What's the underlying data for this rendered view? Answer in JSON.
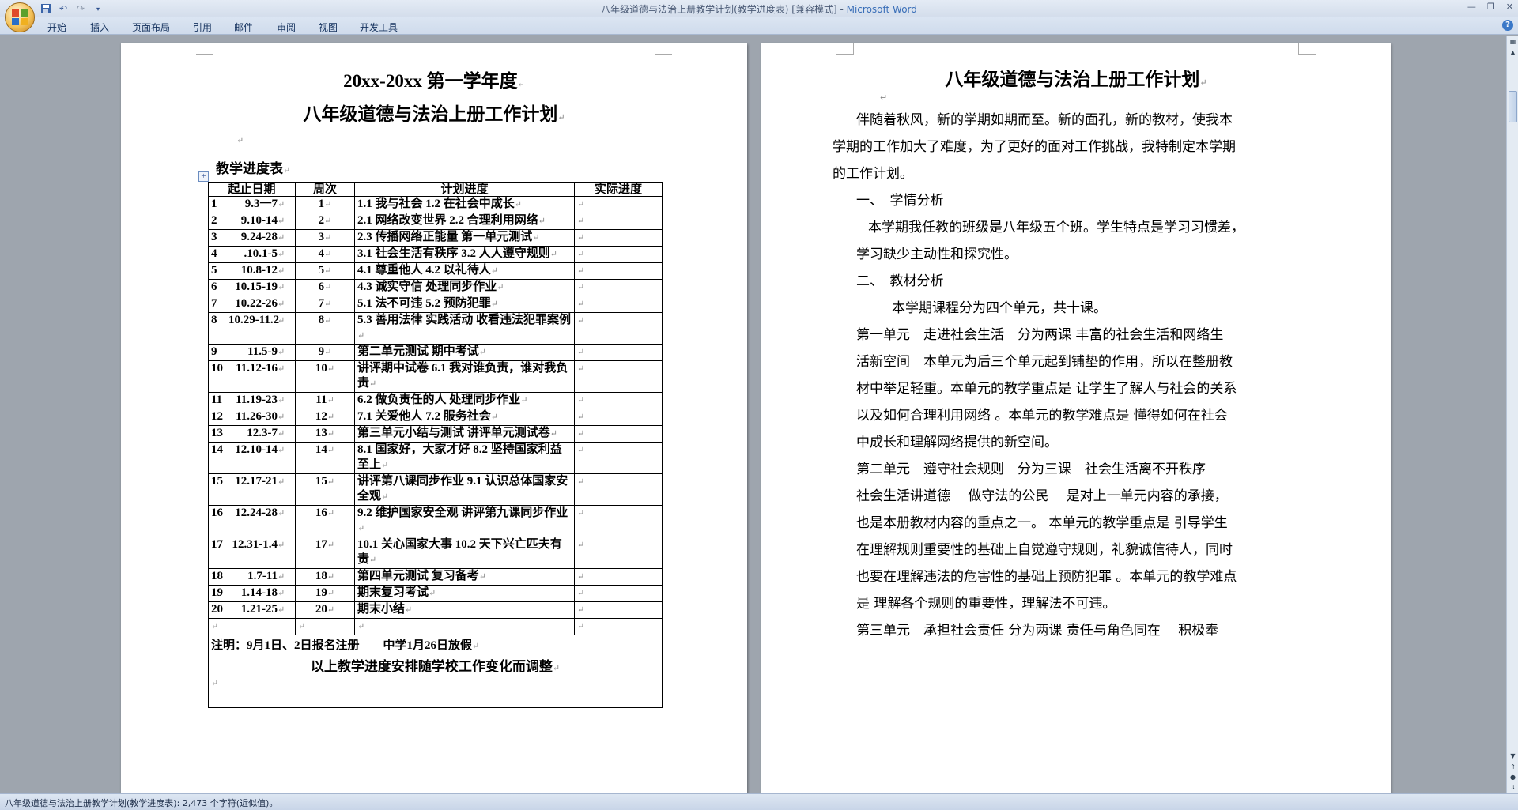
{
  "window": {
    "title_doc": "八年级道德与法治上册教学计划(教学进度表) [兼容模式] - ",
    "title_app": "Microsoft Word"
  },
  "ribbon": {
    "tabs": [
      "开始",
      "插入",
      "页面布局",
      "引用",
      "邮件",
      "审阅",
      "视图",
      "开发工具"
    ]
  },
  "page1": {
    "heading1": "20xx-20xx 第一学年度",
    "heading2": "八年级道德与法治上册工作计划",
    "section_title": "教学进度表",
    "table": {
      "headers": [
        "起止日期",
        "周次",
        "计划进度",
        "实际进度"
      ],
      "rows": [
        {
          "no": "1",
          "date": "9.3一7",
          "week": "1",
          "plan": "1.1 我与社会 1.2 在社会中成长"
        },
        {
          "no": "2",
          "date": "9.10-14",
          "week": "2",
          "plan": "2.1 网络改变世界 2.2 合理利用网络"
        },
        {
          "no": "3",
          "date": "9.24-28",
          "week": "3",
          "plan": "2.3 传播网络正能量 第一单元测试"
        },
        {
          "no": "4",
          "date": ".10.1-5",
          "week": "4",
          "plan": "3.1 社会生活有秩序 3.2 人人遵守规则"
        },
        {
          "no": "5",
          "date": "10.8-12",
          "week": "5",
          "plan": "4.1 尊重他人 4.2 以礼待人"
        },
        {
          "no": "6",
          "date": "10.15-19",
          "week": "6",
          "plan": "4.3 诚实守信 处理同步作业"
        },
        {
          "no": "7",
          "date": "10.22-26",
          "week": "7",
          "plan": "5.1 法不可违 5.2 预防犯罪"
        },
        {
          "no": "8",
          "date": "10.29-11.2",
          "week": "8",
          "plan": "5.3 善用法律 实践活动 收看违法犯罪案例"
        },
        {
          "no": "9",
          "date": "11.5-9",
          "week": "9",
          "plan": "第二单元测试 期中考试"
        },
        {
          "no": "10",
          "date": "11.12-16",
          "week": "10",
          "plan": "讲评期中试卷 6.1 我对谁负责，谁对我负责"
        },
        {
          "no": "11",
          "date": "11.19-23",
          "week": "11",
          "plan": "6.2 做负责任的人 处理同步作业"
        },
        {
          "no": "12",
          "date": "11.26-30",
          "week": "12",
          "plan": "7.1 关爱他人 7.2 服务社会"
        },
        {
          "no": "13",
          "date": "12.3-7",
          "week": "13",
          "plan": "第三单元小结与测试 讲评单元测试卷"
        },
        {
          "no": "14",
          "date": "12.10-14",
          "week": "14",
          "plan": "8.1 国家好，大家才好 8.2 坚持国家利益至上"
        },
        {
          "no": "15",
          "date": "12.17-21",
          "week": "15",
          "plan": "讲评第八课同步作业 9.1 认识总体国家安全观"
        },
        {
          "no": "16",
          "date": "12.24-28",
          "week": "16",
          "plan": "9.2 维护国家安全观 讲评第九课同步作业"
        },
        {
          "no": "17",
          "date": "12.31-1.4",
          "week": "17",
          "plan": "10.1 关心国家大事 10.2 天下兴亡匹夫有责"
        },
        {
          "no": "18",
          "date": "1.7-11",
          "week": "18",
          "plan": "第四单元测试 复习备考"
        },
        {
          "no": "19",
          "date": "1.14-18",
          "week": "19",
          "plan": "期末复习考试"
        },
        {
          "no": "20",
          "date": "1.21-25",
          "week": "20",
          "plan": "期末小结"
        }
      ],
      "note": "注明：9月1日、2日报名注册　　中学1月26日放假",
      "footer": "以上教学进度安排随学校工作变化而调整"
    }
  },
  "page2": {
    "title": "八年级道德与法治上册工作计划",
    "lines": [
      {
        "t": "伴随着秋风，新的学期如期而至。新的面孔，新的教材，使我本",
        "indent": 30
      },
      {
        "t": "学期的工作加大了难度，为了更好的面对工作挑战，我特制定本学期",
        "indent": 0
      },
      {
        "t": "的工作计划。",
        "indent": 0
      },
      {
        "t": "一、　学情分析",
        "indent": 30
      },
      {
        "t": "本学期我任教的班级是八年级五个班。学生特点是学习习惯差，",
        "indent": 45
      },
      {
        "t": "学习缺少主动性和探究性。",
        "indent": 30
      },
      {
        "t": "二、　教材分析",
        "indent": 30
      },
      {
        "t": "本学期课程分为四个单元，共十课。",
        "indent": 75
      },
      {
        "t": "第一单元　走进社会生活　分为两课  丰富的社会生活和网络生",
        "indent": 30
      },
      {
        "t": "活新空间　本单元为后三个单元起到铺垫的作用，所以在整册教",
        "indent": 30
      },
      {
        "t": "材中举足轻重。本单元的教学重点是 让学生了解人与社会的关系",
        "indent": 30
      },
      {
        "t": "以及如何合理利用网络 。本单元的教学难点是 懂得如何在社会",
        "indent": 30
      },
      {
        "t": "中成长和理解网络提供的新空间。",
        "indent": 30
      },
      {
        "t": "第二单元　遵守社会规则　分为三课　社会生活离不开秩序",
        "indent": 30
      },
      {
        "t": "社会生活讲道德　 做守法的公民　 是对上一单元内容的承接，",
        "indent": 30
      },
      {
        "t": "也是本册教材内容的重点之一。 本单元的教学重点是 引导学生",
        "indent": 30
      },
      {
        "t": "在理解规则重要性的基础上自觉遵守规则，礼貌诚信待人，同时",
        "indent": 30
      },
      {
        "t": "也要在理解违法的危害性的基础上预防犯罪 。本单元的教学难点",
        "indent": 30
      },
      {
        "t": "是 理解各个规则的重要性，理解法不可违。",
        "indent": 30
      },
      {
        "t": "第三单元　承担社会责任  分为两课  责任与角色同在　 积极奉",
        "indent": 30
      }
    ]
  },
  "statusbar": {
    "text": "八年级道德与法治上册教学计划(教学进度表): 2,473 个字符(近似值)。"
  },
  "colors": {
    "workspace": "#9ea5ae",
    "ribbon": "#dbe5f2",
    "brand": "#3a6fb8"
  }
}
